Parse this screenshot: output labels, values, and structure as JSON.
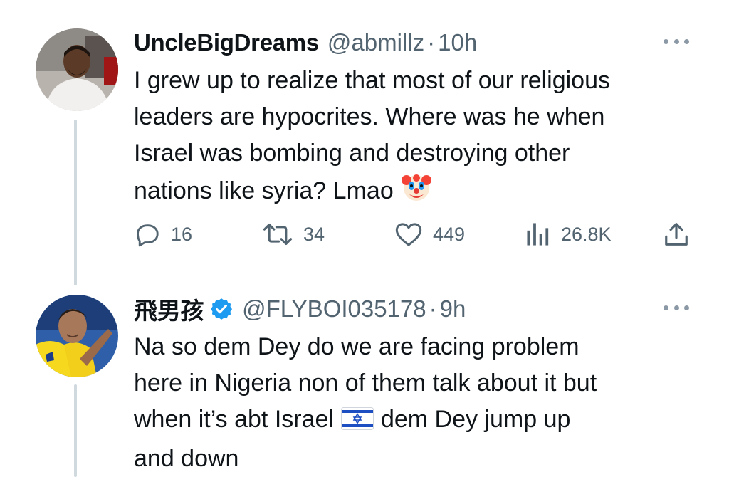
{
  "tweets": [
    {
      "display_name": "UncleBigDreams",
      "handle": "@abmillz",
      "separator": "·",
      "time": "10h",
      "verified": false,
      "text_lines": [
        "I grew up to realize that most of our religious",
        "leaders are hypocrites. Where was he when",
        "Israel was bombing and destroying other",
        "nations like syria? Lmao"
      ],
      "emoji": "clown-face",
      "stats": {
        "replies": "16",
        "retweets": "34",
        "likes": "449",
        "views": "26.8K"
      }
    },
    {
      "display_name": "飛男孩",
      "handle": "@FLYBOI035178",
      "separator": "·",
      "time": "9h",
      "verified": true,
      "text_lines": [
        "Na so dem Dey do we are facing problem",
        "here in Nigeria non of them talk about it but",
        "when it’s abt Israel",
        "dem Dey jump up",
        "and down"
      ],
      "flag": "israel-flag"
    }
  ],
  "colors": {
    "text": "#0f1419",
    "secondary": "#536471",
    "verified_blue": "#1d9bf0",
    "thread_line": "#cfd9de"
  }
}
